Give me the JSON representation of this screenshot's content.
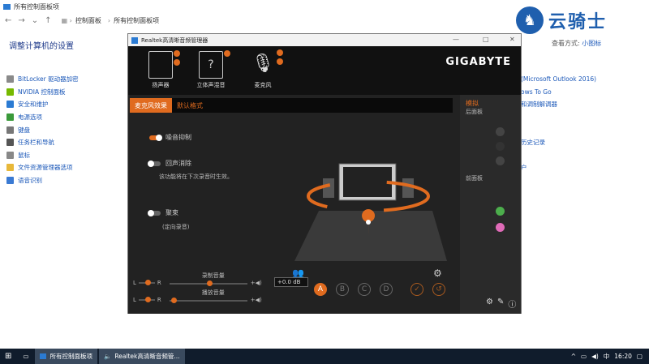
{
  "cp": {
    "title": "所有控制面板项",
    "crumbs": [
      "控制面板",
      "所有控制面板项"
    ],
    "heading": "调整计算机的设置",
    "view_label": "查看方式:",
    "view_value": "小图标",
    "items": [
      {
        "label": "BitLocker 驱动器加密",
        "color": "#8a8a8a"
      },
      {
        "label": "NVIDIA 控制面板",
        "color": "#76b900"
      },
      {
        "label": "安全和维护",
        "color": "#2b7bd3"
      },
      {
        "label": "电源选项",
        "color": "#3a9a3a"
      },
      {
        "label": "键盘",
        "color": "#777"
      },
      {
        "label": "任务栏和导航",
        "color": "#555"
      },
      {
        "label": "鼠标",
        "color": "#888"
      },
      {
        "label": "文件资源管理器选项",
        "color": "#e8b83a"
      },
      {
        "label": "语音识别",
        "color": "#3a7ad3"
      }
    ],
    "right_items": [
      "(Microsoft Outlook 2016)",
      "ows To Go",
      "和调制解调器",
      "",
      "",
      "历史记录",
      "",
      "户"
    ]
  },
  "logo": {
    "text": "云骑士"
  },
  "realtek": {
    "title": "Realtek高清晰音频管理器",
    "brand": "GIGABYTE",
    "devices": [
      "扬声器",
      "立体声混音",
      "麦克风"
    ],
    "tabs": [
      "麦克风效果",
      "默认格式"
    ],
    "options": [
      {
        "label": "噪音抑制",
        "on": true
      },
      {
        "label": "回声消除",
        "on": false,
        "desc": "该功能将在下次录音时生效。"
      },
      {
        "label": "聚束",
        "on": false,
        "desc": "(定向录音)"
      }
    ],
    "side": {
      "title": "模拟",
      "back": "后面板",
      "front": "前面板"
    },
    "record_label": "录制音量",
    "playback_label": "播放音量",
    "db_value": "+0.0 dB",
    "l": "L",
    "r": "R",
    "abcd": [
      "A",
      "B",
      "C",
      "D"
    ]
  },
  "taskbar": {
    "apps": [
      "所有控制面板项",
      "Realtek高清晰音频管..."
    ],
    "ime": "中",
    "time": "16:20"
  }
}
